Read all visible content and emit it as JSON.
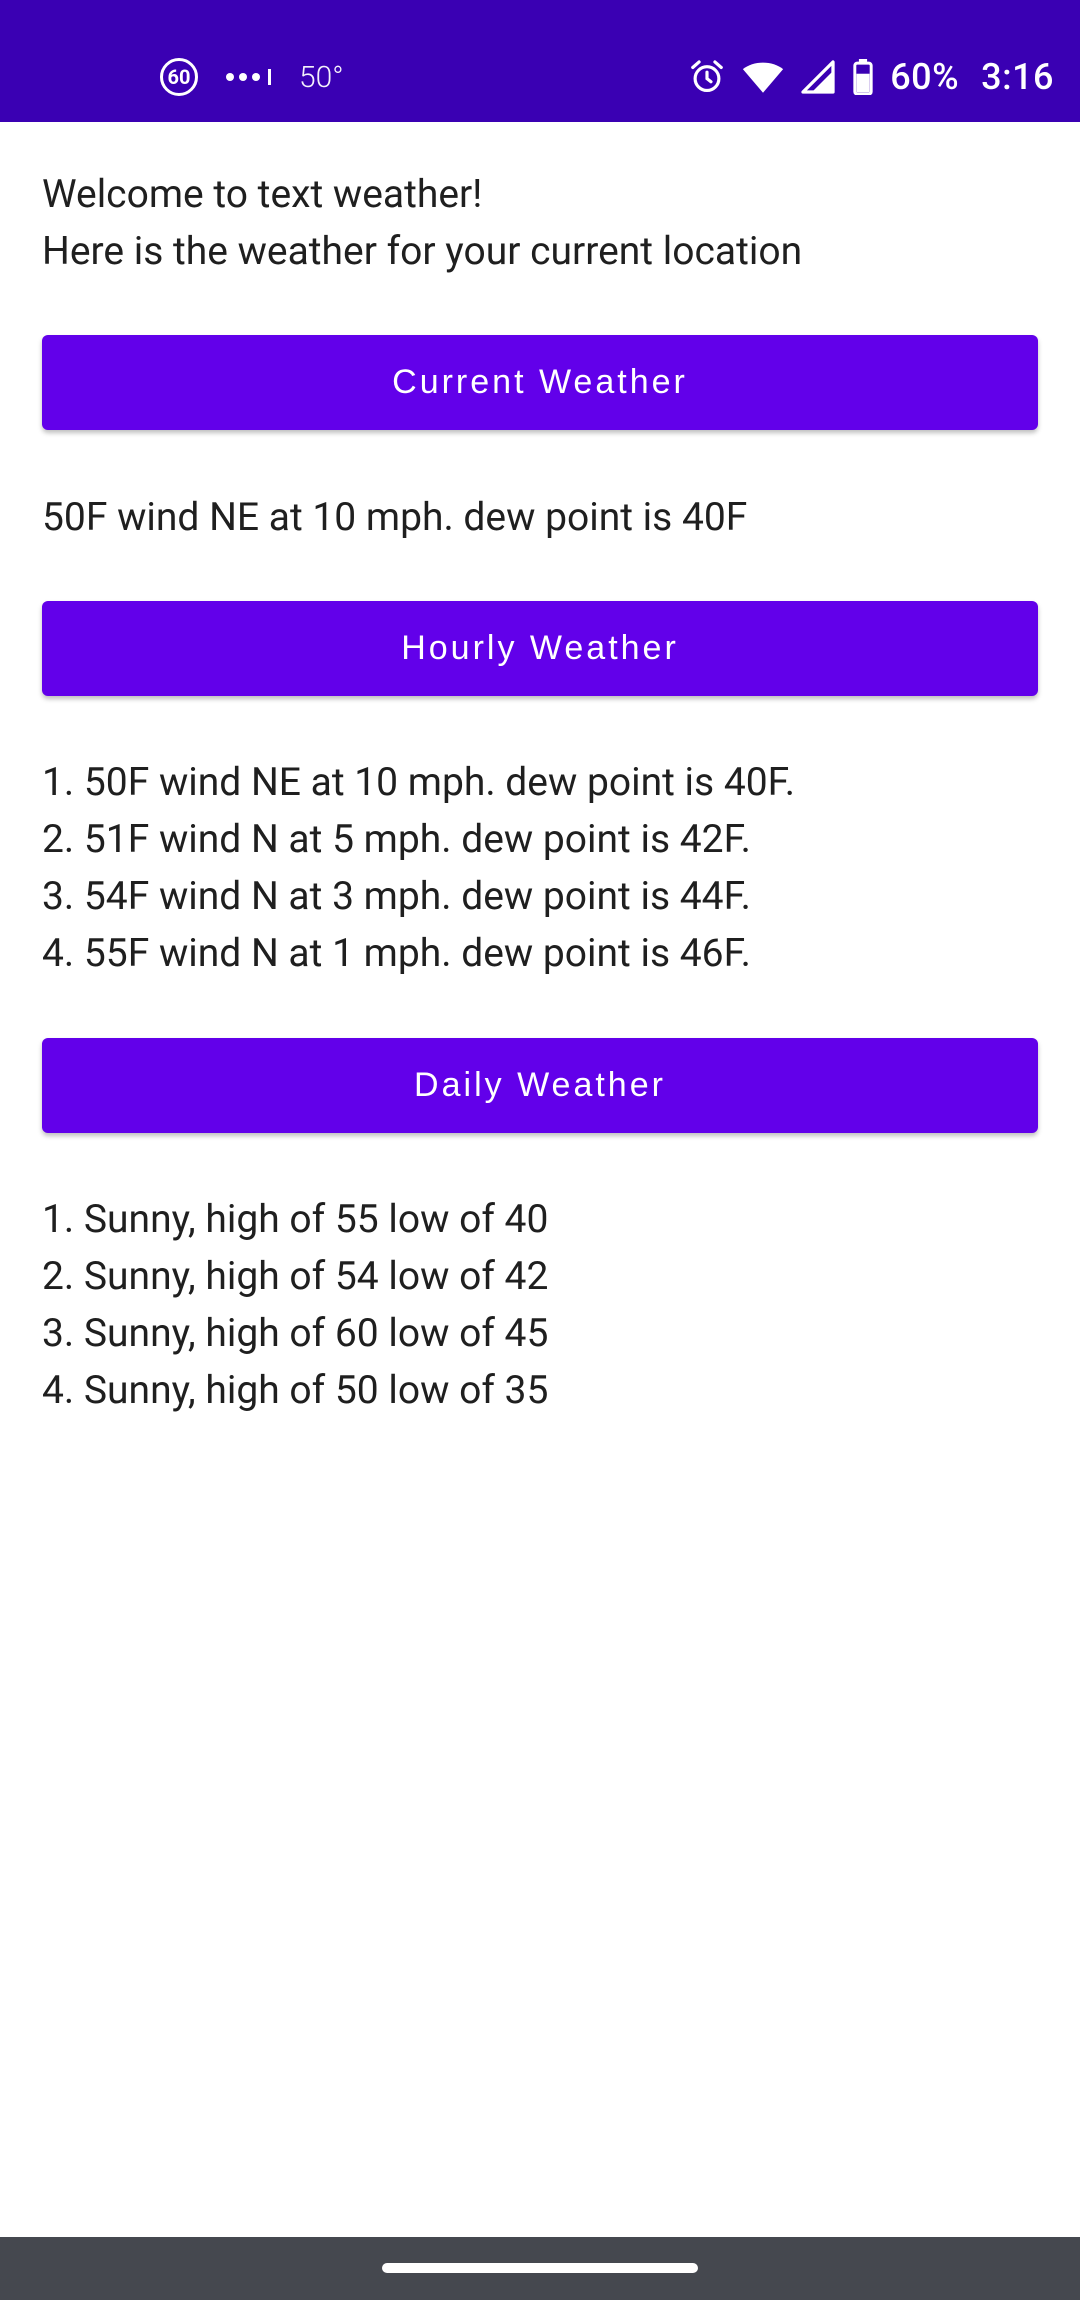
{
  "status_bar": {
    "badge_text": "60",
    "temperature": "50°",
    "battery_percent": "60%",
    "time": "3:16",
    "icons": [
      "speed-limit-badge-icon",
      "signal-dots-icon",
      "alarm-icon",
      "wifi-icon",
      "cellular-icon",
      "battery-icon"
    ]
  },
  "intro": {
    "line1": "Welcome to text weather!",
    "line2": "Here is the weather for your current location"
  },
  "current": {
    "button_label": "Current Weather",
    "text": "50F wind NE at 10 mph. dew point is 40F"
  },
  "hourly": {
    "button_label": "Hourly Weather",
    "items": [
      "1. 50F wind NE at 10 mph. dew point is 40F.",
      "2. 51F wind N at 5 mph. dew point is 42F.",
      "3. 54F wind N at 3 mph. dew point is 44F.",
      "4. 55F wind N at 1 mph. dew point is 46F."
    ]
  },
  "daily": {
    "button_label": "Daily Weather",
    "items": [
      "1. Sunny, high of 55 low of 40",
      "2. Sunny, high of 54 low of 42",
      "3. Sunny, high of 60 low of 45",
      "4. Sunny, high of 50 low of 35"
    ]
  },
  "colors": {
    "status_bar": "#3a00b3",
    "button": "#6200ea",
    "nav_bar": "#45484f"
  }
}
